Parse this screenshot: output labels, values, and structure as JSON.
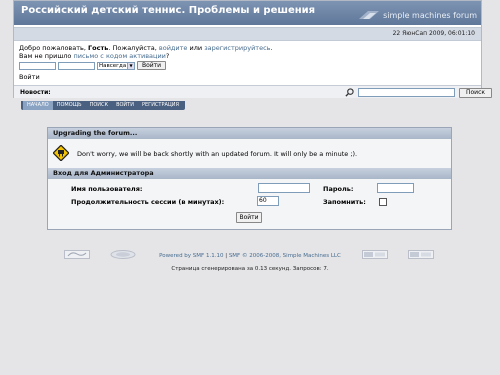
{
  "header": {
    "title": "Российский детский теннис. Проблемы и решения",
    "brand": "simple machines forum",
    "date": "22 ЯюнСап 2009, 06:01:10"
  },
  "login": {
    "welcome_prefix": "Добро пожаловать, ",
    "guest": "Гость",
    "welcome_mid": ". Пожалуйста, ",
    "login_link": "войдите",
    "or": " или ",
    "register_link": "зарегистрируйтесь",
    "welcome_end": ".",
    "missed_prefix": "Вам не пришло ",
    "activation_link": "письмо с кодом активации",
    "missed_end": "?",
    "duration": "Навсегда",
    "login_button": "Войти",
    "bottom_label": "Войти"
  },
  "newsbar": {
    "label": "Новости:",
    "search_button": "Поиск"
  },
  "menu": {
    "items": [
      "Начало",
      "Помощь",
      "Поиск",
      "Войти",
      "Регистрация"
    ]
  },
  "panel": {
    "upgrade_title": "Upgrading the forum...",
    "upgrade_message": "Don't worry, we will be back shortly with an updated forum. It will only be a minute ;).",
    "admin_title": "Вход для Администратора",
    "username_label": "Имя пользователя:",
    "password_label": "Пароль:",
    "session_label": "Продолжительность сессии (в минутах):",
    "session_value": "60",
    "remember_label": "Запомнить:",
    "login_button": "Войти"
  },
  "footer": {
    "powered": "Powered by SMF 1.1.10",
    "sep": " | ",
    "copyright": "SMF © 2006-2008, Simple Machines LLC",
    "generated": "Страница сгенерирована за 0.13 секунд. Запросов: 7."
  },
  "colors": {
    "title_bar": "#6a82a4",
    "link": "#476c8e",
    "tab_bar": "#4a6080"
  }
}
